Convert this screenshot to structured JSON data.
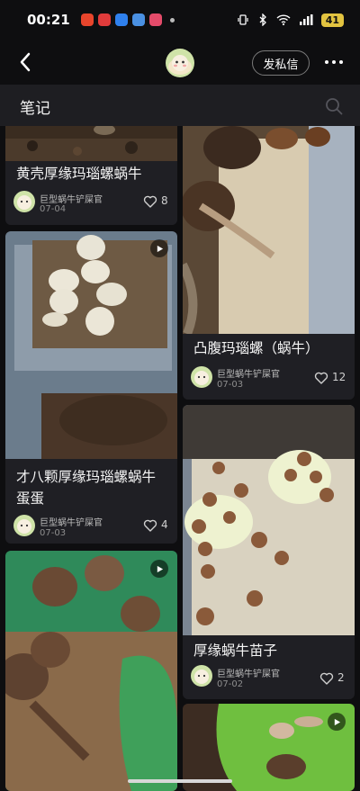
{
  "status_bar": {
    "time": "00:21",
    "battery": "41"
  },
  "header": {
    "message_button": "发私信"
  },
  "section": {
    "title": "笔记"
  },
  "notes": [
    {
      "title": "黄壳厚缘玛瑙螺蜗牛",
      "author": "巨型蜗牛铲屎官",
      "date": "07-04",
      "likes": "8",
      "is_video": false
    },
    {
      "title": "凸腹玛瑙螺（蜗牛）",
      "author": "巨型蜗牛铲屎官",
      "date": "07-03",
      "likes": "12",
      "is_video": false
    },
    {
      "title_line1": "才八颗厚缘玛瑙螺蜗牛",
      "title_line2": "蛋蛋",
      "author": "巨型蜗牛铲屎官",
      "date": "07-03",
      "likes": "4",
      "is_video": true
    },
    {
      "title": "厚缘蜗牛苗子",
      "author": "巨型蜗牛铲屎官",
      "date": "07-02",
      "likes": "2",
      "is_video": false
    },
    {
      "is_video": true
    },
    {
      "is_video": true
    }
  ],
  "icons": {
    "back": "chevron-left-icon",
    "more": "more-dots-icon",
    "search": "search-icon",
    "like": "heart-outline-icon",
    "video": "play-icon"
  },
  "colors": {
    "background": "#0e0e10",
    "card": "#1f1f24",
    "header": "#1e1e22",
    "battery": "#e2c340"
  }
}
